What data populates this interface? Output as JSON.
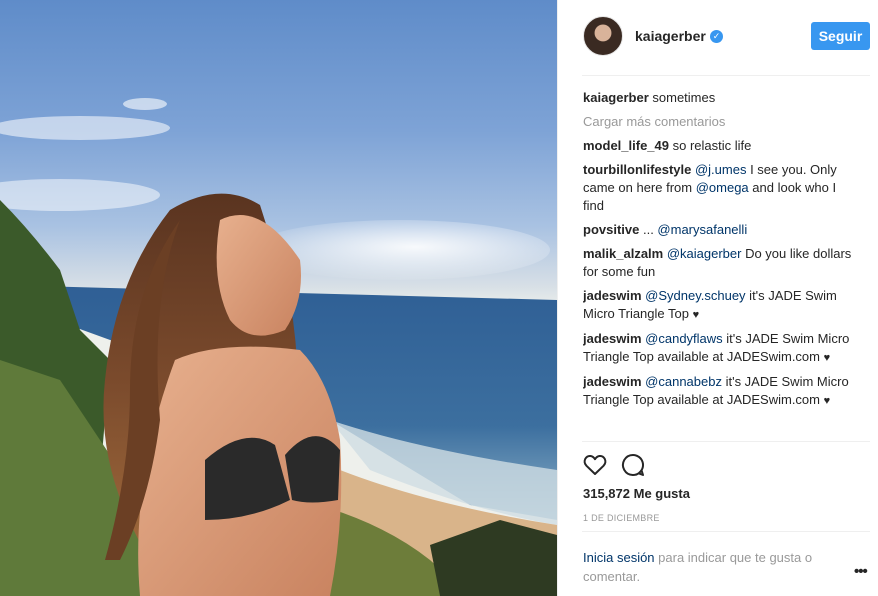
{
  "post": {
    "username": "kaiagerber",
    "verified_icon": "verified-badge-icon",
    "follow_label": "Seguir",
    "caption_user": "kaiagerber",
    "caption_text": "sometimes",
    "load_more": "Cargar más comentarios",
    "comments": [
      {
        "user": "model_life_49",
        "parts": [
          {
            "t": " so relastic life"
          }
        ]
      },
      {
        "user": "tourbillonlifestyle",
        "parts": [
          {
            "t": " "
          },
          {
            "m": "@j.umes"
          },
          {
            "t": " I see you. Only came on here from "
          },
          {
            "m": "@omega"
          },
          {
            "t": " and look who I find"
          }
        ]
      },
      {
        "user": "povsitive",
        "parts": [
          {
            "t": " ... "
          },
          {
            "m": "@marysafanelli"
          }
        ]
      },
      {
        "user": "malik_alzalm",
        "parts": [
          {
            "t": " "
          },
          {
            "m": "@kaiagerber"
          },
          {
            "t": " Do you like dollars for some fun"
          }
        ]
      },
      {
        "user": "jadeswim",
        "parts": [
          {
            "t": " "
          },
          {
            "m": "@Sydney.schuey"
          },
          {
            "t": " it's JADE Swim Micro Triangle Top "
          },
          {
            "h": "♥"
          }
        ]
      },
      {
        "user": "jadeswim",
        "parts": [
          {
            "t": " "
          },
          {
            "m": "@candyflaws"
          },
          {
            "t": " it's JADE Swim Micro Triangle Top available at JADESwim.com "
          },
          {
            "h": "♥"
          }
        ]
      },
      {
        "user": "jadeswim",
        "parts": [
          {
            "t": " "
          },
          {
            "m": "@cannabebz"
          },
          {
            "t": " it's JADE Swim Micro Triangle Top available at JADESwim.com "
          },
          {
            "h": "♥"
          }
        ]
      }
    ],
    "likes_count": "315,872",
    "likes_label": "Me gusta",
    "date": "1 DE DICIEMBRE",
    "login_link": "Inicia sesión",
    "login_text": " para indicar que te gusta o comentar.",
    "more_label": "•••"
  },
  "colors": {
    "accent": "#3897f0",
    "mention": "#003569",
    "muted": "#999999",
    "text": "#262626"
  }
}
